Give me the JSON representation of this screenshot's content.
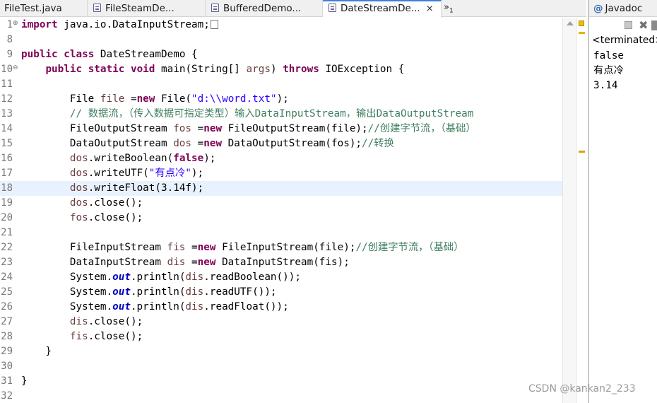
{
  "editor": {
    "tabs": [
      {
        "label": "FileTest.java"
      },
      {
        "label": "FileSteamDe..."
      },
      {
        "label": "BufferedDemo..."
      },
      {
        "label": "DateStreamDe...",
        "active": true,
        "close": "×"
      }
    ],
    "overflow": {
      "symbol": "»",
      "count": "1"
    }
  },
  "code": {
    "lines": [
      {
        "n": "1",
        "fold": "+",
        "parts": [
          {
            "t": "import",
            "c": "kw"
          },
          {
            "t": " java.io.DataInputStream;"
          }
        ],
        "box": true
      },
      {
        "n": "8",
        "parts": []
      },
      {
        "n": "9",
        "parts": [
          {
            "t": "public",
            "c": "kw"
          },
          {
            "t": " "
          },
          {
            "t": "class",
            "c": "kw"
          },
          {
            "t": " DateStreamDemo {"
          }
        ]
      },
      {
        "n": "10",
        "fold": "-",
        "parts": [
          {
            "t": "    "
          },
          {
            "t": "public",
            "c": "kw"
          },
          {
            "t": " "
          },
          {
            "t": "static",
            "c": "kw"
          },
          {
            "t": " "
          },
          {
            "t": "void",
            "c": "kw"
          },
          {
            "t": " main(String[] "
          },
          {
            "t": "args",
            "c": "var"
          },
          {
            "t": ") "
          },
          {
            "t": "throws",
            "c": "kw"
          },
          {
            "t": " IOException {"
          }
        ]
      },
      {
        "n": "11",
        "parts": []
      },
      {
        "n": "12",
        "parts": [
          {
            "t": "        File "
          },
          {
            "t": "file",
            "c": "var"
          },
          {
            "t": " ="
          },
          {
            "t": "new",
            "c": "kw"
          },
          {
            "t": " File("
          },
          {
            "t": "\"d:\\\\word.txt\"",
            "c": "str"
          },
          {
            "t": ");"
          }
        ]
      },
      {
        "n": "13",
        "parts": [
          {
            "t": "        "
          },
          {
            "t": "// 数据流，（传入数据可指定类型）输入DataInputStream，输出DataOutputStream",
            "c": "cmt"
          }
        ]
      },
      {
        "n": "14",
        "parts": [
          {
            "t": "        FileOutputStream "
          },
          {
            "t": "fos",
            "c": "var"
          },
          {
            "t": " ="
          },
          {
            "t": "new",
            "c": "kw"
          },
          {
            "t": " FileOutputStream(file);"
          },
          {
            "t": "//创建字节流，（基础）",
            "c": "cmt"
          }
        ]
      },
      {
        "n": "15",
        "parts": [
          {
            "t": "        DataOutputStream "
          },
          {
            "t": "dos",
            "c": "var"
          },
          {
            "t": " ="
          },
          {
            "t": "new",
            "c": "kw"
          },
          {
            "t": " DataOutputStream(fos);"
          },
          {
            "t": "//转换",
            "c": "cmt"
          }
        ]
      },
      {
        "n": "16",
        "parts": [
          {
            "t": "        "
          },
          {
            "t": "dos",
            "c": "var"
          },
          {
            "t": ".writeBoolean("
          },
          {
            "t": "false",
            "c": "kw"
          },
          {
            "t": ");"
          }
        ]
      },
      {
        "n": "17",
        "parts": [
          {
            "t": "        "
          },
          {
            "t": "dos",
            "c": "var"
          },
          {
            "t": ".writeUTF("
          },
          {
            "t": "\"有点冷\"",
            "c": "str"
          },
          {
            "t": ");"
          }
        ]
      },
      {
        "n": "18",
        "current": true,
        "parts": [
          {
            "t": "        "
          },
          {
            "t": "dos",
            "c": "var"
          },
          {
            "t": ".writeFloat(3.14f);"
          }
        ]
      },
      {
        "n": "19",
        "parts": [
          {
            "t": "        "
          },
          {
            "t": "dos",
            "c": "var"
          },
          {
            "t": ".close();"
          }
        ]
      },
      {
        "n": "20",
        "parts": [
          {
            "t": "        "
          },
          {
            "t": "fos",
            "c": "var"
          },
          {
            "t": ".close();"
          }
        ]
      },
      {
        "n": "21",
        "parts": []
      },
      {
        "n": "22",
        "parts": [
          {
            "t": "        FileInputStream "
          },
          {
            "t": "fis",
            "c": "var"
          },
          {
            "t": " ="
          },
          {
            "t": "new",
            "c": "kw"
          },
          {
            "t": " FileInputStream(file);"
          },
          {
            "t": "//创建字节流，（基础）",
            "c": "cmt"
          }
        ]
      },
      {
        "n": "23",
        "parts": [
          {
            "t": "        DataInputStream "
          },
          {
            "t": "dis",
            "c": "var"
          },
          {
            "t": " ="
          },
          {
            "t": "new",
            "c": "kw"
          },
          {
            "t": " DataInputStream(fis);"
          }
        ]
      },
      {
        "n": "24",
        "parts": [
          {
            "t": "        System."
          },
          {
            "t": "out",
            "c": "fld"
          },
          {
            "t": ".println("
          },
          {
            "t": "dis",
            "c": "var"
          },
          {
            "t": ".readBoolean());"
          }
        ]
      },
      {
        "n": "25",
        "parts": [
          {
            "t": "        System."
          },
          {
            "t": "out",
            "c": "fld"
          },
          {
            "t": ".println("
          },
          {
            "t": "dis",
            "c": "var"
          },
          {
            "t": ".readUTF());"
          }
        ]
      },
      {
        "n": "26",
        "parts": [
          {
            "t": "        System."
          },
          {
            "t": "out",
            "c": "fld"
          },
          {
            "t": ".println("
          },
          {
            "t": "dis",
            "c": "var"
          },
          {
            "t": ".readFloat());"
          }
        ]
      },
      {
        "n": "27",
        "parts": [
          {
            "t": "        "
          },
          {
            "t": "dis",
            "c": "var"
          },
          {
            "t": ".close();"
          }
        ]
      },
      {
        "n": "28",
        "parts": [
          {
            "t": "        "
          },
          {
            "t": "fis",
            "c": "var"
          },
          {
            "t": ".close();"
          }
        ]
      },
      {
        "n": "29",
        "parts": [
          {
            "t": "    }"
          }
        ]
      },
      {
        "n": "30",
        "parts": []
      },
      {
        "n": "31",
        "parts": [
          {
            "t": "}"
          }
        ]
      },
      {
        "n": "32",
        "parts": []
      }
    ]
  },
  "console": {
    "tab_label": "Javadoc",
    "tab_symbol": "@",
    "status": "<terminated>",
    "output": [
      "false",
      "有点冷",
      "3.14"
    ]
  },
  "watermark": "CSDN @kankan2_233"
}
